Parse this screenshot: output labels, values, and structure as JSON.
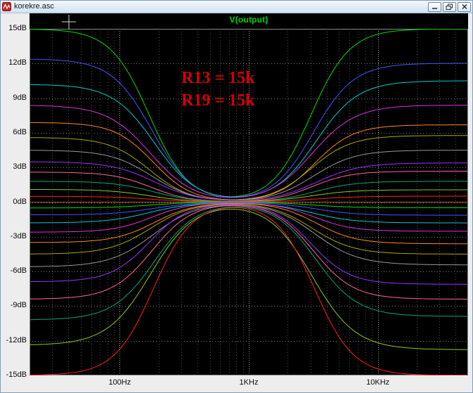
{
  "window": {
    "title": "korekre.asc"
  },
  "plot": {
    "trace_label": "V(output)",
    "trace_label_color": "#00d500",
    "background_color": "#000000",
    "annotation": {
      "lines": [
        "R13 = 15k",
        "R19 = 15k"
      ],
      "color": "#d40000"
    }
  },
  "chart_data": {
    "type": "line",
    "title": "V(output)",
    "x_axis": {
      "scale": "log",
      "unit": "Hz",
      "min_hz": 20,
      "max_hz": 50000,
      "tick_values_hz": [
        100,
        1000,
        10000
      ],
      "tick_labels": [
        "100Hz",
        "1KHz",
        "10KHz"
      ]
    },
    "y_axis": {
      "unit": "dB",
      "min_db": -15,
      "max_db": 15,
      "step_db": 3,
      "tick_labels": [
        "15dB",
        "12dB",
        "9dB",
        "6dB",
        "3dB",
        "0dB",
        "-3dB",
        "-6dB",
        "-9dB",
        "-12dB",
        "-15dB"
      ]
    },
    "grid": {
      "style": "dotted",
      "minor_color": "#505050",
      "major_color": "#9a9a9a",
      "horizontal_color": "#787878"
    },
    "model": {
      "description": "Stepped tone-control frequency-response family: every curve pinches to 0 dB near 750 Hz and shelves toward end_gain_db at both frequency extremes (bass shelf ~180 Hz, treble shelf ~3 kHz).",
      "center_hz": 750,
      "shelf_offset_decades": 0.625,
      "transition_width_decades": 0.32
    },
    "series": [
      {
        "end_gain_db": 15,
        "color": "#00dd00"
      },
      {
        "end_gain_db": 12.4,
        "color": "#4455ff"
      },
      {
        "end_gain_db": 10.2,
        "color": "#00cccc"
      },
      {
        "end_gain_db": 8.4,
        "color": "#dd33dd"
      },
      {
        "end_gain_db": 6.9,
        "color": "#ff8822"
      },
      {
        "end_gain_db": 5.6,
        "color": "#aaaa00"
      },
      {
        "end_gain_db": 4.5,
        "color": "#999999"
      },
      {
        "end_gain_db": 3.5,
        "color": "#9933ff"
      },
      {
        "end_gain_db": 2.6,
        "color": "#ff6699"
      },
      {
        "end_gain_db": 1.8,
        "color": "#00aa77"
      },
      {
        "end_gain_db": 1.1,
        "color": "#88cc22"
      },
      {
        "end_gain_db": 0.5,
        "color": "#ff2222"
      },
      {
        "end_gain_db": 0,
        "color": "#aa5522"
      },
      {
        "end_gain_db": -0.5,
        "color": "#00dd00"
      },
      {
        "end_gain_db": -1.1,
        "color": "#4455ff"
      },
      {
        "end_gain_db": -1.8,
        "color": "#00cccc"
      },
      {
        "end_gain_db": -2.6,
        "color": "#dd33dd"
      },
      {
        "end_gain_db": -3.5,
        "color": "#ff8822"
      },
      {
        "end_gain_db": -4.5,
        "color": "#aaaa00"
      },
      {
        "end_gain_db": -5.6,
        "color": "#999999"
      },
      {
        "end_gain_db": -6.9,
        "color": "#9933ff"
      },
      {
        "end_gain_db": -8.4,
        "color": "#ff6699"
      },
      {
        "end_gain_db": -10.2,
        "color": "#00aa77"
      },
      {
        "end_gain_db": -12.4,
        "color": "#88cc22"
      },
      {
        "end_gain_db": -15,
        "color": "#ff2222"
      }
    ]
  }
}
